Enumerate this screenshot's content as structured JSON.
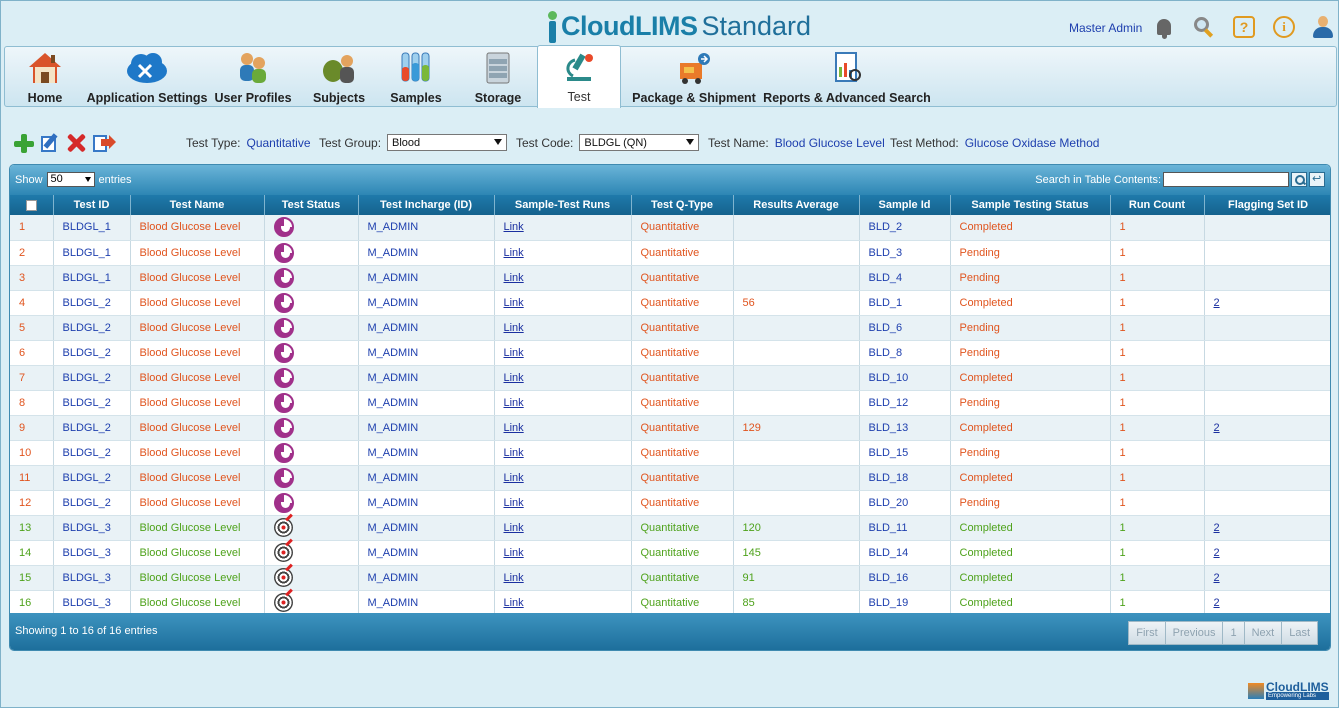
{
  "brand": {
    "name1": "CloudLIMS",
    "name2": "Standard"
  },
  "header": {
    "user": "Master Admin",
    "icons": [
      "bell-icon",
      "search-icon",
      "help-icon",
      "info-icon",
      "user-icon"
    ]
  },
  "nav": [
    {
      "label": "Home",
      "icon": "home-icon"
    },
    {
      "label": "Application Settings",
      "icon": "cloud-settings-icon"
    },
    {
      "label": "User Profiles",
      "icon": "users-icon"
    },
    {
      "label": "Subjects",
      "icon": "subjects-icon"
    },
    {
      "label": "Samples",
      "icon": "test-tubes-icon"
    },
    {
      "label": "Storage",
      "icon": "freezer-icon"
    },
    {
      "label": "Test",
      "icon": "microscope-icon",
      "active": true
    },
    {
      "label": "Package & Shipment",
      "icon": "shipment-icon"
    },
    {
      "label": "Reports & Advanced Search",
      "icon": "report-icon"
    }
  ],
  "toolbar": {
    "test_type_label": "Test Type:",
    "test_type_value": "Quantitative",
    "test_group_label": "Test Group:",
    "test_group_value": "Blood",
    "test_code_label": "Test Code:",
    "test_code_value": "BLDGL (QN)",
    "test_name_label": "Test Name:",
    "test_name_value": "Blood Glucose Level",
    "test_method_label": "Test Method:",
    "test_method_value": "Glucose Oxidase Method"
  },
  "table_controls": {
    "show_label": "Show",
    "show_value": "50",
    "entries_label": "entries",
    "search_label": "Search in Table Contents:"
  },
  "columns": [
    "Test ID",
    "Test Name",
    "Test Status",
    "Test Incharge (ID)",
    "Sample-Test Runs",
    "Test Q-Type",
    "Results Average",
    "Sample Id",
    "Sample Testing Status",
    "Run Count",
    "Flagging Set ID"
  ],
  "rows": [
    {
      "n": "1",
      "test_id": "BLDGL_1",
      "test_name": "Blood Glucose Level",
      "status_icon": "in-progress-icon",
      "incharge": "M_ADMIN",
      "runs": "Link",
      "qtype": "Quantitative",
      "avg": "",
      "sample_id": "BLD_2",
      "testing_status": "Completed",
      "run_count": "1",
      "flag": "",
      "color": "orange"
    },
    {
      "n": "2",
      "test_id": "BLDGL_1",
      "test_name": "Blood Glucose Level",
      "status_icon": "in-progress-icon",
      "incharge": "M_ADMIN",
      "runs": "Link",
      "qtype": "Quantitative",
      "avg": "",
      "sample_id": "BLD_3",
      "testing_status": "Pending",
      "run_count": "1",
      "flag": "",
      "color": "orange"
    },
    {
      "n": "3",
      "test_id": "BLDGL_1",
      "test_name": "Blood Glucose Level",
      "status_icon": "in-progress-icon",
      "incharge": "M_ADMIN",
      "runs": "Link",
      "qtype": "Quantitative",
      "avg": "",
      "sample_id": "BLD_4",
      "testing_status": "Pending",
      "run_count": "1",
      "flag": "",
      "color": "orange"
    },
    {
      "n": "4",
      "test_id": "BLDGL_2",
      "test_name": "Blood Glucose Level",
      "status_icon": "in-progress-icon",
      "incharge": "M_ADMIN",
      "runs": "Link",
      "qtype": "Quantitative",
      "avg": "56",
      "sample_id": "BLD_1",
      "testing_status": "Completed",
      "run_count": "1",
      "flag": "2",
      "color": "orange"
    },
    {
      "n": "5",
      "test_id": "BLDGL_2",
      "test_name": "Blood Glucose Level",
      "status_icon": "in-progress-icon",
      "incharge": "M_ADMIN",
      "runs": "Link",
      "qtype": "Quantitative",
      "avg": "",
      "sample_id": "BLD_6",
      "testing_status": "Pending",
      "run_count": "1",
      "flag": "",
      "color": "orange"
    },
    {
      "n": "6",
      "test_id": "BLDGL_2",
      "test_name": "Blood Glucose Level",
      "status_icon": "in-progress-icon",
      "incharge": "M_ADMIN",
      "runs": "Link",
      "qtype": "Quantitative",
      "avg": "",
      "sample_id": "BLD_8",
      "testing_status": "Pending",
      "run_count": "1",
      "flag": "",
      "color": "orange"
    },
    {
      "n": "7",
      "test_id": "BLDGL_2",
      "test_name": "Blood Glucose Level",
      "status_icon": "in-progress-icon",
      "incharge": "M_ADMIN",
      "runs": "Link",
      "qtype": "Quantitative",
      "avg": "",
      "sample_id": "BLD_10",
      "testing_status": "Completed",
      "run_count": "1",
      "flag": "",
      "color": "orange"
    },
    {
      "n": "8",
      "test_id": "BLDGL_2",
      "test_name": "Blood Glucose Level",
      "status_icon": "in-progress-icon",
      "incharge": "M_ADMIN",
      "runs": "Link",
      "qtype": "Quantitative",
      "avg": "",
      "sample_id": "BLD_12",
      "testing_status": "Pending",
      "run_count": "1",
      "flag": "",
      "color": "orange"
    },
    {
      "n": "9",
      "test_id": "BLDGL_2",
      "test_name": "Blood Glucose Level",
      "status_icon": "in-progress-icon",
      "incharge": "M_ADMIN",
      "runs": "Link",
      "qtype": "Quantitative",
      "avg": "129",
      "sample_id": "BLD_13",
      "testing_status": "Completed",
      "run_count": "1",
      "flag": "2",
      "color": "orange"
    },
    {
      "n": "10",
      "test_id": "BLDGL_2",
      "test_name": "Blood Glucose Level",
      "status_icon": "in-progress-icon",
      "incharge": "M_ADMIN",
      "runs": "Link",
      "qtype": "Quantitative",
      "avg": "",
      "sample_id": "BLD_15",
      "testing_status": "Pending",
      "run_count": "1",
      "flag": "",
      "color": "orange"
    },
    {
      "n": "11",
      "test_id": "BLDGL_2",
      "test_name": "Blood Glucose Level",
      "status_icon": "in-progress-icon",
      "incharge": "M_ADMIN",
      "runs": "Link",
      "qtype": "Quantitative",
      "avg": "",
      "sample_id": "BLD_18",
      "testing_status": "Completed",
      "run_count": "1",
      "flag": "",
      "color": "orange"
    },
    {
      "n": "12",
      "test_id": "BLDGL_2",
      "test_name": "Blood Glucose Level",
      "status_icon": "in-progress-icon",
      "incharge": "M_ADMIN",
      "runs": "Link",
      "qtype": "Quantitative",
      "avg": "",
      "sample_id": "BLD_20",
      "testing_status": "Pending",
      "run_count": "1",
      "flag": "",
      "color": "orange"
    },
    {
      "n": "13",
      "test_id": "BLDGL_3",
      "test_name": "Blood Glucose Level",
      "status_icon": "target-icon",
      "incharge": "M_ADMIN",
      "runs": "Link",
      "qtype": "Quantitative",
      "avg": "120",
      "sample_id": "BLD_11",
      "testing_status": "Completed",
      "run_count": "1",
      "flag": "2",
      "color": "green"
    },
    {
      "n": "14",
      "test_id": "BLDGL_3",
      "test_name": "Blood Glucose Level",
      "status_icon": "target-icon",
      "incharge": "M_ADMIN",
      "runs": "Link",
      "qtype": "Quantitative",
      "avg": "145",
      "sample_id": "BLD_14",
      "testing_status": "Completed",
      "run_count": "1",
      "flag": "2",
      "color": "green"
    },
    {
      "n": "15",
      "test_id": "BLDGL_3",
      "test_name": "Blood Glucose Level",
      "status_icon": "target-icon",
      "incharge": "M_ADMIN",
      "runs": "Link",
      "qtype": "Quantitative",
      "avg": "91",
      "sample_id": "BLD_16",
      "testing_status": "Completed",
      "run_count": "1",
      "flag": "2",
      "color": "green"
    },
    {
      "n": "16",
      "test_id": "BLDGL_3",
      "test_name": "Blood Glucose Level",
      "status_icon": "target-icon",
      "incharge": "M_ADMIN",
      "runs": "Link",
      "qtype": "Quantitative",
      "avg": "85",
      "sample_id": "BLD_19",
      "testing_status": "Completed",
      "run_count": "1",
      "flag": "2",
      "color": "green"
    }
  ],
  "footer": {
    "info": "Showing 1 to 16 of 16 entries",
    "pager": [
      "First",
      "Previous",
      "1",
      "Next",
      "Last"
    ],
    "logo_text": "CloudLIMS",
    "logo_tagline": "Empowering Labs"
  }
}
